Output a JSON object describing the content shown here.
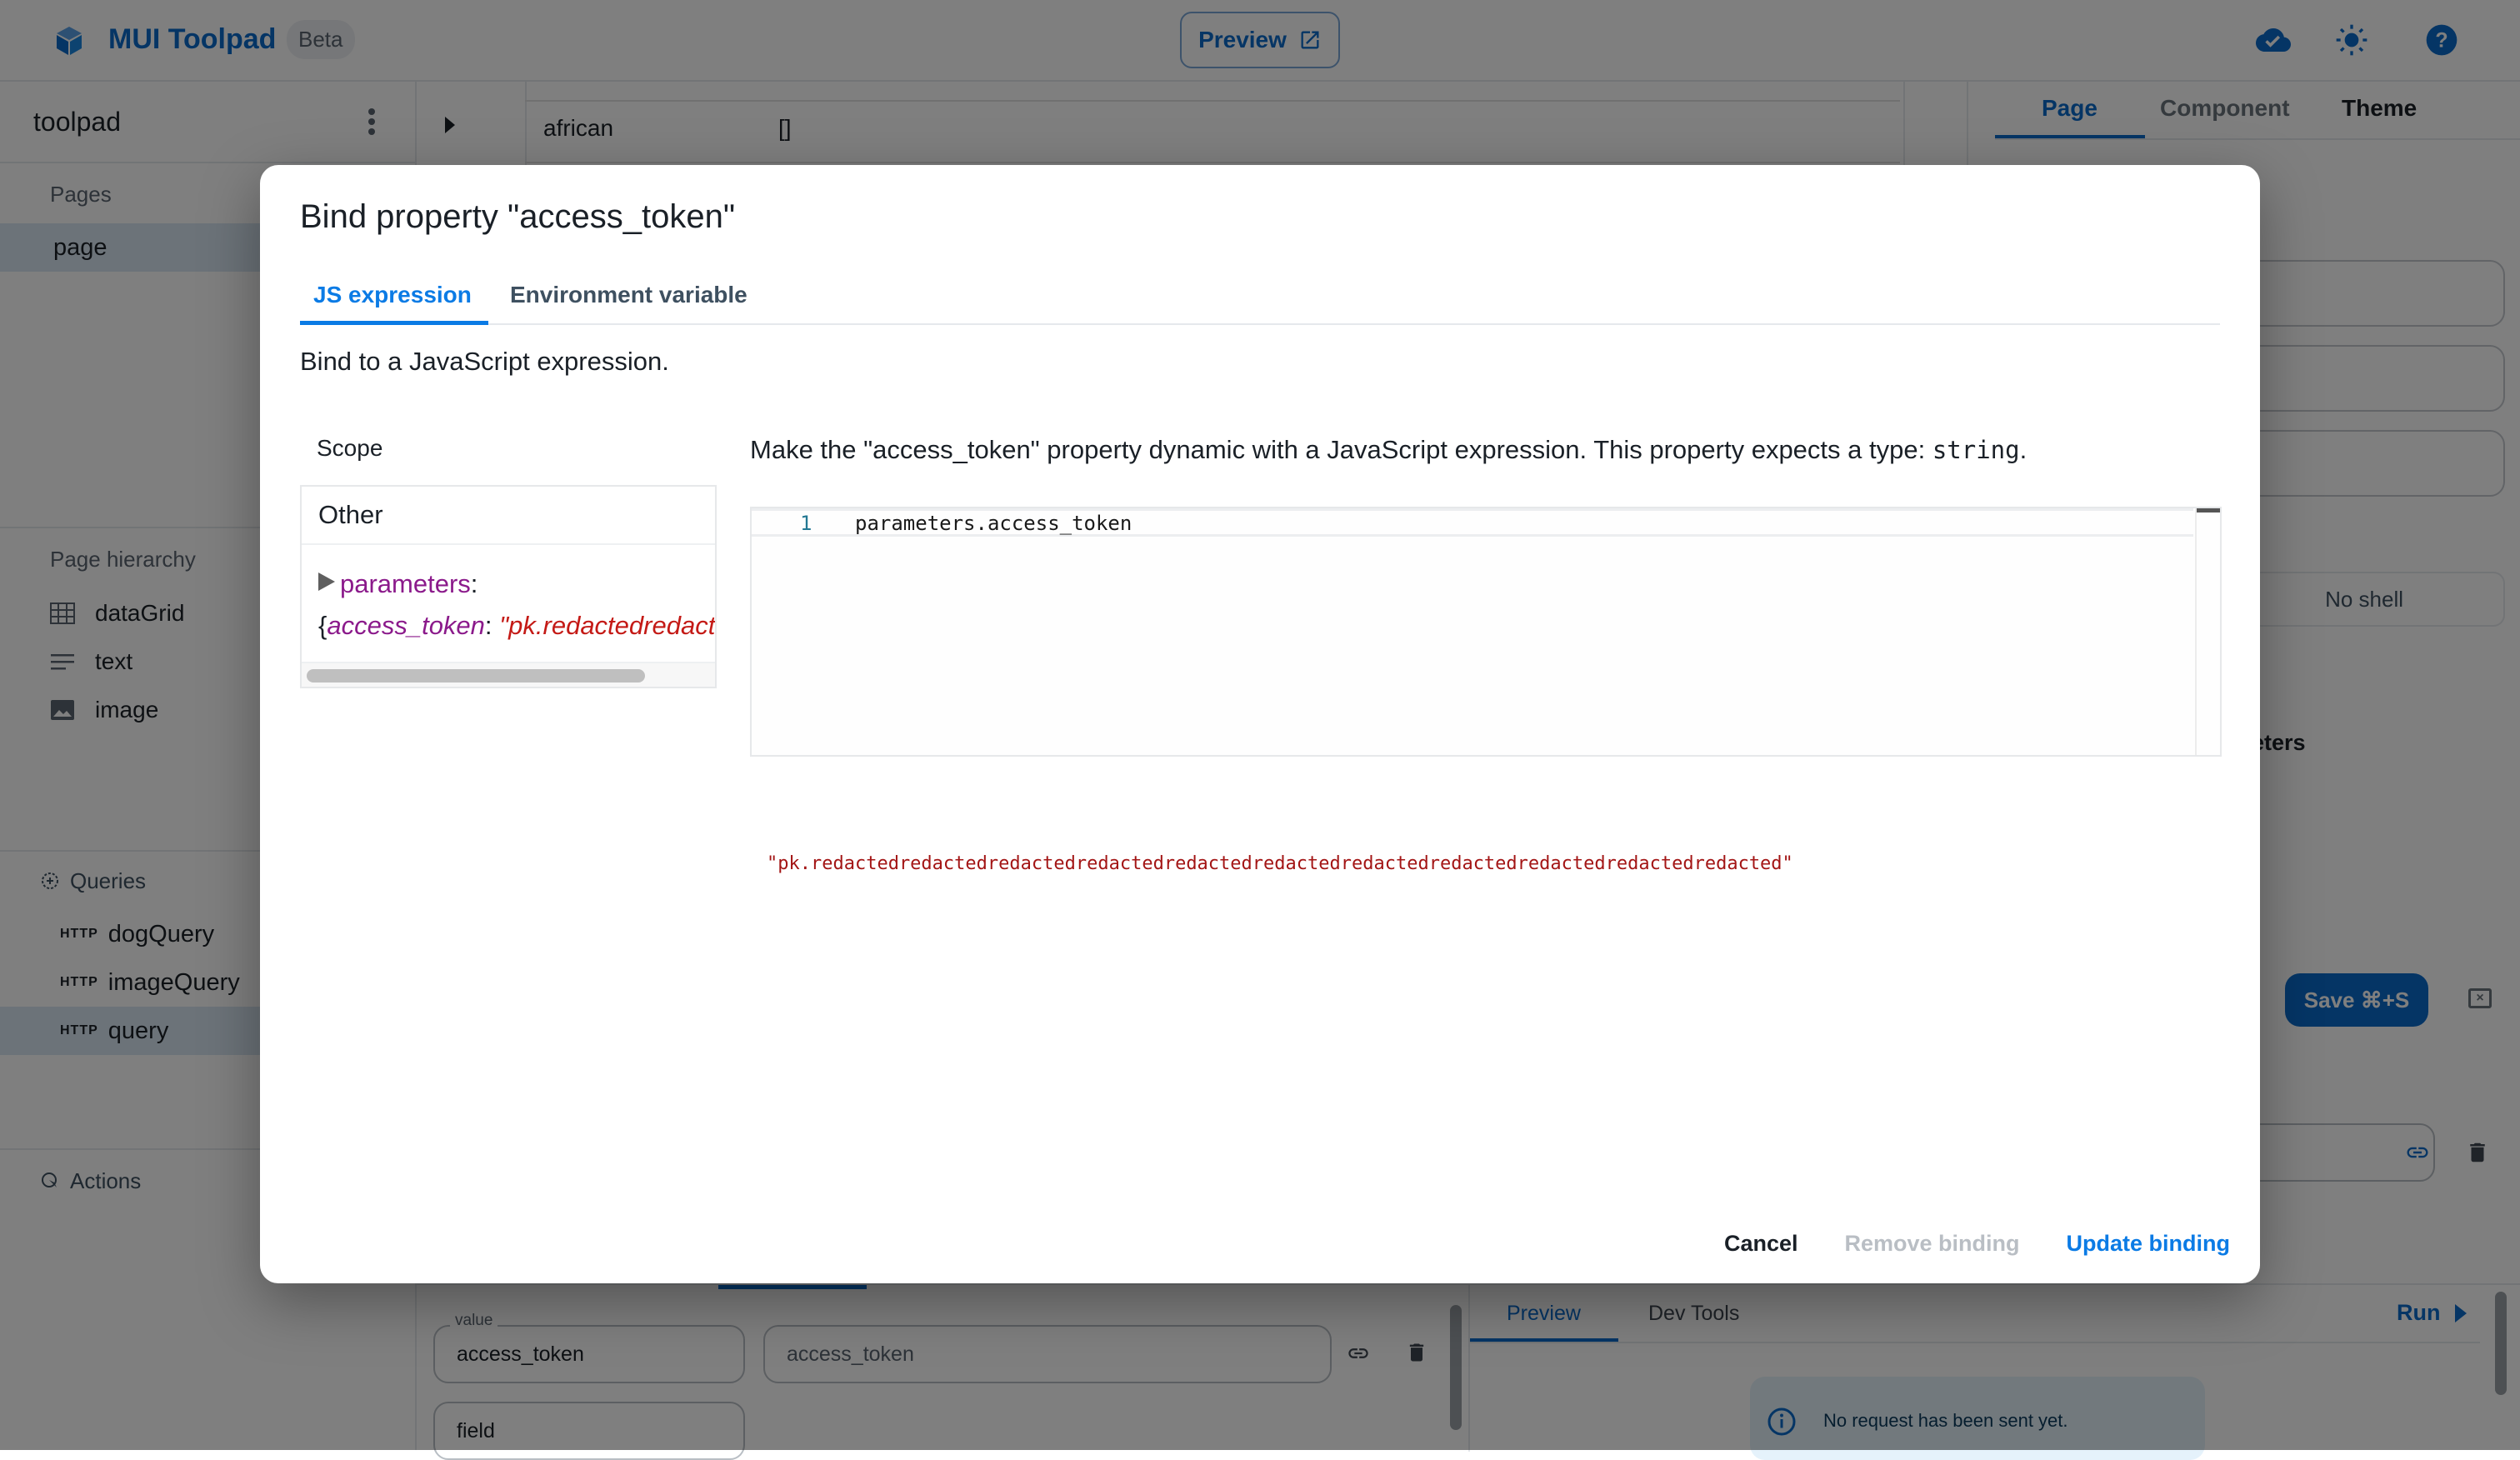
{
  "app": {
    "brand": "MUI Toolpad",
    "badge": "Beta",
    "preview_label": "Preview",
    "icons": [
      "cloud-check-icon",
      "sun-icon",
      "help-icon"
    ]
  },
  "left_panel": {
    "project_name": "toolpad",
    "pages_title": "Pages",
    "pages": [
      {
        "label": "page",
        "selected": true
      }
    ],
    "hierarchy_title": "Page hierarchy",
    "hierarchy": [
      {
        "label": "dataGrid",
        "icon": "grid-icon"
      },
      {
        "label": "text",
        "icon": "text-lines-icon"
      },
      {
        "label": "image",
        "icon": "image-icon"
      }
    ],
    "queries_title": "Queries",
    "queries": [
      {
        "tag": "HTTP",
        "label": "dogQuery",
        "selected": false
      },
      {
        "tag": "HTTP",
        "label": "imageQuery",
        "selected": false
      },
      {
        "tag": "HTTP",
        "label": "query",
        "selected": true
      }
    ],
    "actions_title": "Actions"
  },
  "canvas": {
    "grid_row_label": "african",
    "grid_row_value": "[]"
  },
  "right_panel": {
    "tabs": [
      "Page",
      "Component",
      "Theme"
    ],
    "active_tab": "Page",
    "shell_option": "No shell",
    "partial_heading": "eters",
    "save_label": "Save ⌘+S"
  },
  "query_editor": {
    "param_label": "value",
    "param_name": "access_token",
    "param_value": "access_token",
    "next_field": "field",
    "preview_tabs": [
      "Preview",
      "Dev Tools"
    ],
    "run_label": "Run",
    "info_text": "No request has been sent yet."
  },
  "dialog": {
    "title": "Bind property \"access_token\"",
    "tabs": [
      {
        "label": "JS expression",
        "active": true
      },
      {
        "label": "Environment variable",
        "active": false
      }
    ],
    "description": "Bind to a JavaScript expression.",
    "scope": {
      "title": "Scope",
      "group": "Other",
      "key": "parameters",
      "colon": ":",
      "open_brace": "{",
      "child_key": "access_token",
      "child_value_preview": "\"pk.redactedredactedredacted"
    },
    "hint_prefix": "Make the \"access_token\" property dynamic with a JavaScript expression. This property expects a type: ",
    "hint_type": "string",
    "hint_suffix": ".",
    "editor": {
      "line_number": "1",
      "code": "parameters.access_token"
    },
    "result": "\"pk.redactedredactedredactedredactedredactedredactedredactedredactedredactedredactedredacted\"",
    "buttons": {
      "cancel": "Cancel",
      "remove": "Remove binding",
      "update": "Update binding"
    }
  }
}
